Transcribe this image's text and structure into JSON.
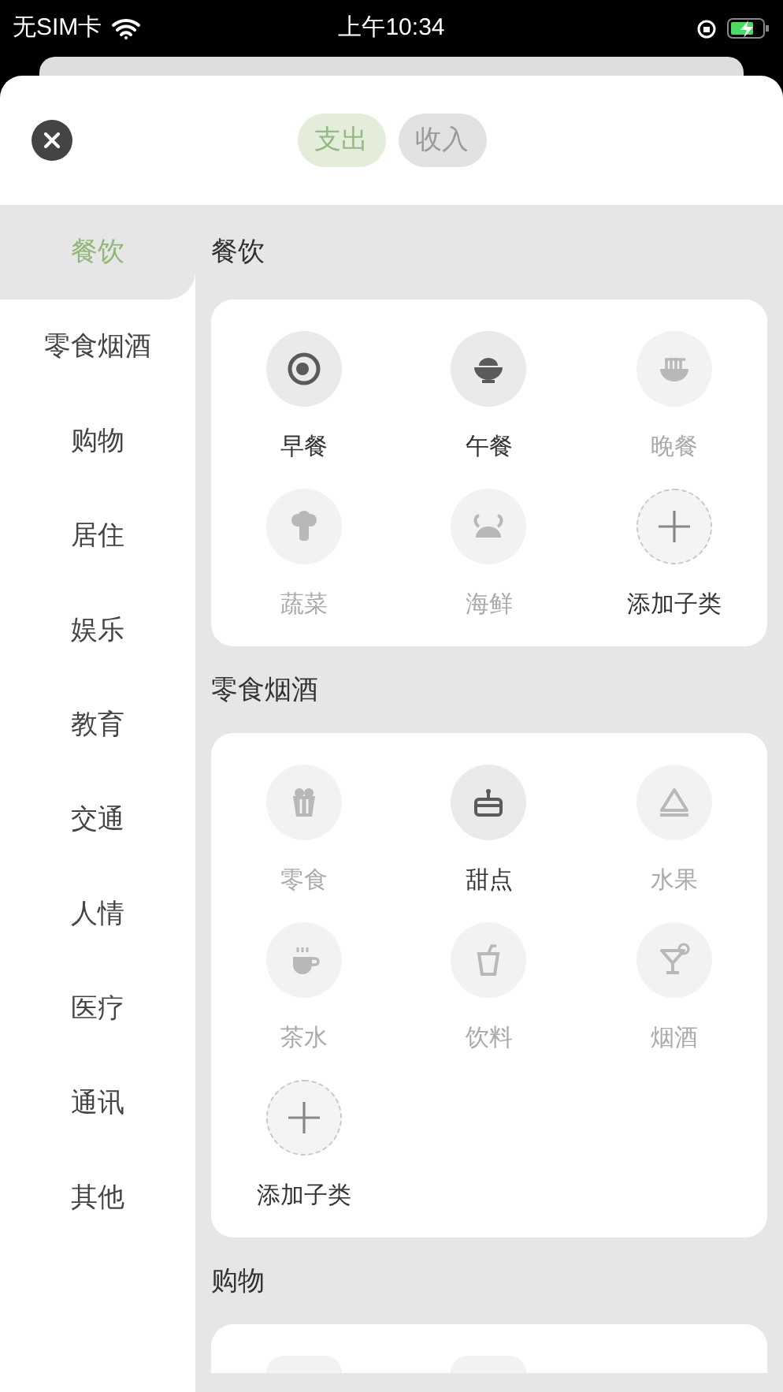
{
  "status_bar": {
    "carrier": "无SIM卡",
    "time": "上午10:34"
  },
  "tabs": [
    {
      "label": "支出",
      "selected": true
    },
    {
      "label": "收入",
      "selected": false
    }
  ],
  "sidebar": {
    "items": [
      {
        "label": "餐饮",
        "selected": true
      },
      {
        "label": "零食烟酒",
        "selected": false
      },
      {
        "label": "购物",
        "selected": false
      },
      {
        "label": "居住",
        "selected": false
      },
      {
        "label": "娱乐",
        "selected": false
      },
      {
        "label": "教育",
        "selected": false
      },
      {
        "label": "交通",
        "selected": false
      },
      {
        "label": "人情",
        "selected": false
      },
      {
        "label": "医疗",
        "selected": false
      },
      {
        "label": "通讯",
        "selected": false
      },
      {
        "label": "其他",
        "selected": false
      }
    ]
  },
  "sections": [
    {
      "title": "餐饮",
      "items": [
        {
          "kind": "category",
          "label": "早餐",
          "dimmed": false
        },
        {
          "kind": "category",
          "label": "午餐",
          "dimmed": false
        },
        {
          "kind": "category",
          "label": "晚餐",
          "dimmed": true
        },
        {
          "kind": "category",
          "label": "蔬菜",
          "dimmed": true
        },
        {
          "kind": "category",
          "label": "海鲜",
          "dimmed": true
        },
        {
          "kind": "add",
          "label": "添加子类"
        }
      ]
    },
    {
      "title": "零食烟酒",
      "items": [
        {
          "kind": "category",
          "label": "零食",
          "dimmed": true
        },
        {
          "kind": "category",
          "label": "甜点",
          "dimmed": false
        },
        {
          "kind": "category",
          "label": "水果",
          "dimmed": true
        },
        {
          "kind": "category",
          "label": "茶水",
          "dimmed": true
        },
        {
          "kind": "category",
          "label": "饮料",
          "dimmed": true
        },
        {
          "kind": "category",
          "label": "烟酒",
          "dimmed": true
        },
        {
          "kind": "add",
          "label": "添加子类"
        }
      ]
    },
    {
      "title": "购物"
    }
  ]
}
